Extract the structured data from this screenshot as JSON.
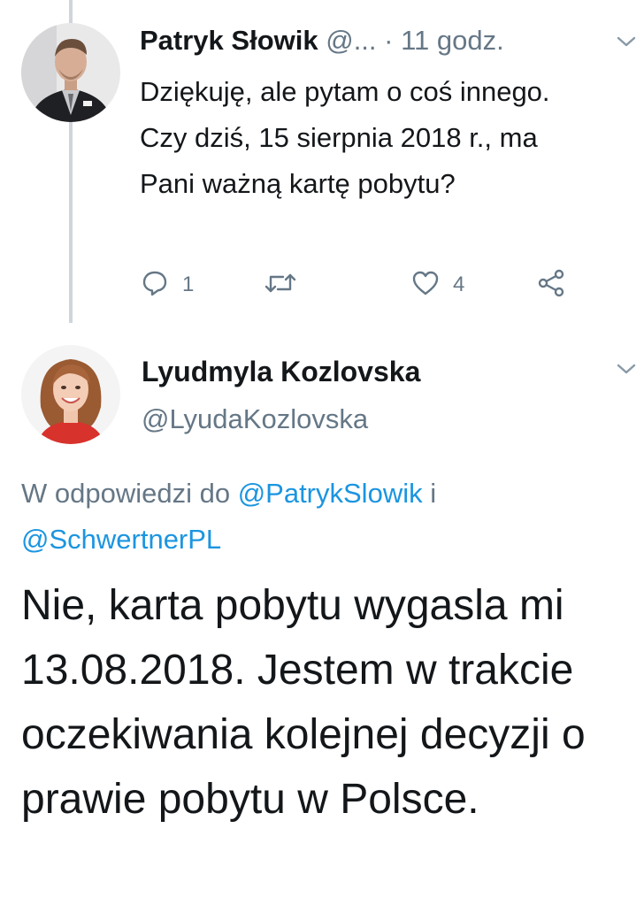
{
  "tweet1": {
    "name": "Patryk Słowik",
    "handle": "@...",
    "separator": "·",
    "time": "11 godz.",
    "text": "Dziękuję, ale pytam o coś innego. Czy dziś, 15 sierpnia 2018 r., ma Pani ważną kartę pobytu?",
    "reply_count": "1",
    "like_count": "4",
    "icons": {
      "reply": "reply-icon",
      "retweet": "retweet-icon",
      "like": "heart-icon",
      "share": "share-icon",
      "menu": "chevron-down-icon"
    }
  },
  "tweet2": {
    "name": "Lyudmyla Kozlovska",
    "handle": "@LyudaKozlovska",
    "reply_prefix": "W odpowiedzi do ",
    "reply_user1": "@PatrykSlowik",
    "reply_joiner": " i ",
    "reply_user2": "@SchwertnerPL",
    "text": "Nie, karta pobytu wygasla mi 13.08.2018. Jestem w trakcie oczekiwania kolejnej decyzji o prawie pobytu w Polsce."
  },
  "colors": {
    "text": "#14171a",
    "secondary": "#657786",
    "link": "#1b95e0",
    "thread_line": "#cfd5da"
  }
}
